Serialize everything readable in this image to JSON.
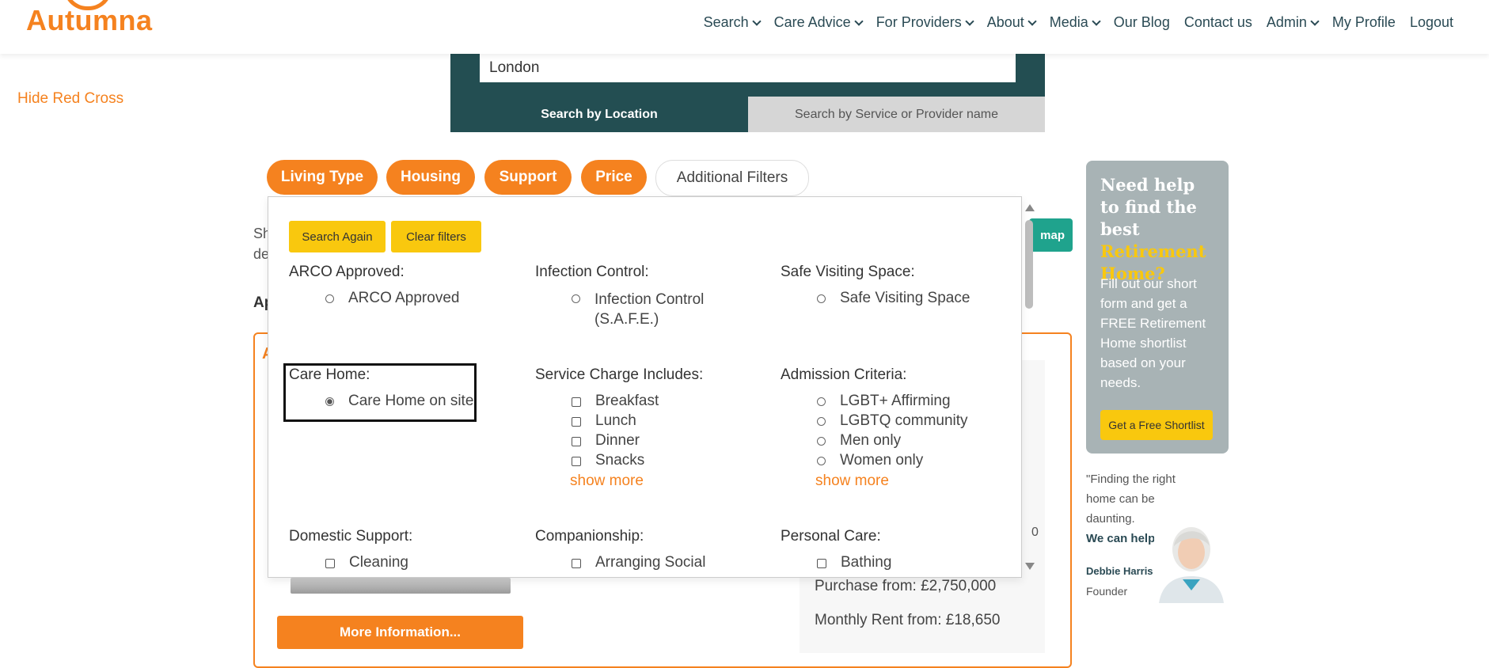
{
  "header": {
    "logo": "Autumna",
    "nav": [
      {
        "label": "Search",
        "dropdown": true
      },
      {
        "label": "Care Advice",
        "dropdown": true
      },
      {
        "label": "For Providers",
        "dropdown": true
      },
      {
        "label": "About",
        "dropdown": true
      },
      {
        "label": "Media",
        "dropdown": true
      },
      {
        "label": "Our Blog",
        "dropdown": false
      },
      {
        "label": "Contact us",
        "dropdown": false
      },
      {
        "label": "Admin",
        "dropdown": true
      },
      {
        "label": "My Profile",
        "dropdown": false
      },
      {
        "label": "Logout",
        "dropdown": false
      }
    ]
  },
  "search": {
    "location_value": "London",
    "tab_location": "Search by Location",
    "tab_service": "Search by Service or Provider name"
  },
  "hide_red_cross": "Hide Red Cross",
  "filters": {
    "pills": [
      "Living Type",
      "Housing",
      "Support",
      "Price",
      "Additional Filters"
    ]
  },
  "background": {
    "snippet_1": "Sh",
    "snippet_2": "de",
    "snippet_3": "Ap",
    "snippet_4": "A",
    "map_label": "map",
    "number_hint": "0",
    "purchase": "Purchase from: £2,750,000",
    "rent": "Monthly Rent from: £18,650",
    "more_info": "More Information..."
  },
  "dropdown": {
    "search_again": "Search Again",
    "clear_filters": "Clear filters",
    "groups": {
      "arco": {
        "title": "ARCO Approved:",
        "options": [
          "ARCO Approved"
        ]
      },
      "infection": {
        "title": "Infection Control:",
        "options": [
          "Infection Control (S.A.F.E.)"
        ]
      },
      "visiting": {
        "title": "Safe Visiting Space:",
        "options": [
          "Safe Visiting Space"
        ]
      },
      "care_home": {
        "title": "Care Home:",
        "options": [
          "Care Home on site"
        ],
        "selected": "Care Home on site"
      },
      "service_charge": {
        "title": "Service Charge Includes:",
        "options": [
          "Breakfast",
          "Lunch",
          "Dinner",
          "Snacks"
        ],
        "show_more": "show more"
      },
      "admission": {
        "title": "Admission Criteria:",
        "options": [
          "LGBT+ Affirming",
          "LGBTQ community",
          "Men only",
          "Women only"
        ],
        "show_more": "show more"
      },
      "domestic": {
        "title": "Domestic Support:",
        "options": [
          "Cleaning"
        ]
      },
      "companionship": {
        "title": "Companionship:",
        "options": [
          "Arranging Social"
        ]
      },
      "personal": {
        "title": "Personal Care:",
        "options": [
          "Bathing"
        ]
      }
    }
  },
  "sidebar": {
    "heading_1": "Need help to find the best",
    "heading_2": "Retirement Home?",
    "body": "Fill out our short form and get a FREE Retirement Home shortlist based on your needs.",
    "button": "Get a Free Shortlist",
    "quote": "\"Finding the right home can be daunting.",
    "quote_bold": "We can help.\"",
    "name": "Debbie Harris",
    "role": "Founder"
  },
  "colors": {
    "brand_orange": "#f5821f",
    "teal": "#234e52",
    "yellow": "#f9c80e",
    "cta_grey": "#a8b3b5"
  }
}
